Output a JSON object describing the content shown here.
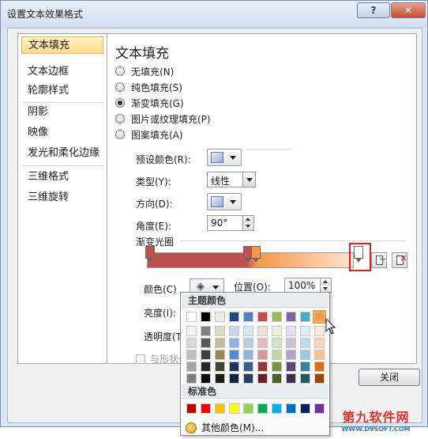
{
  "window": {
    "title": "设置文本效果格式",
    "help_label": "?",
    "close_label": "✕"
  },
  "nav": {
    "items": [
      {
        "label": "文本填充",
        "selected": true
      },
      {
        "label": "文本边框"
      },
      {
        "label": "轮廓样式"
      },
      {
        "label": "阴影"
      },
      {
        "label": "映像"
      },
      {
        "label": "发光和柔化边缘"
      },
      {
        "label": "三维格式"
      },
      {
        "label": "三维旋转"
      }
    ]
  },
  "panel": {
    "heading": "文本填充",
    "fill_options": [
      {
        "label": "无填充(N)"
      },
      {
        "label": "纯色填充(S)"
      },
      {
        "label": "渐变填充(G)",
        "selected": true
      },
      {
        "label": "图片或纹理填充(P)"
      },
      {
        "label": "图案填充(A)"
      }
    ],
    "preset_label": "预设颜色(R):",
    "type_label": "类型(Y):",
    "type_value": "线性",
    "direction_label": "方向(D):",
    "angle_label": "角度(E):",
    "angle_value": "90°",
    "gradient_stops_label": "渐变光圈",
    "color_label": "颜色(C)",
    "position_label": "位置(O):",
    "position_value": "100%",
    "brightness_label": "亮度(I):",
    "transparency_label": "透明度(T):",
    "rotate_with_shape_label": "与形状一",
    "close_button": "关闭"
  },
  "color_popup": {
    "theme_header": "主题颜色",
    "standard_header": "标准色",
    "more_colors": "其他颜色(M)...",
    "theme_top_row": [
      "#ffffff",
      "#000000",
      "#eeece1",
      "#1f497d",
      "#4f81bd",
      "#c0504d",
      "#9bbb59",
      "#8064a2",
      "#4bacc6",
      "#f79646"
    ],
    "theme_shades": [
      [
        "#f2f2f2",
        "#7f7f7f",
        "#ddd9c3",
        "#c6d9f0",
        "#dbe5f1",
        "#f2dcdb",
        "#ebf1dd",
        "#e5e0ec",
        "#dbeef3",
        "#fdeada"
      ],
      [
        "#d8d8d8",
        "#595959",
        "#c4bd97",
        "#8db3e2",
        "#b8cce4",
        "#e5b9b7",
        "#d7e3bc",
        "#ccc1d9",
        "#b7dde8",
        "#fbd5b5"
      ],
      [
        "#bfbfbf",
        "#3f3f3f",
        "#938953",
        "#548dd4",
        "#95b3d7",
        "#d99694",
        "#c3d69b",
        "#b2a2c7",
        "#92cddc",
        "#fac08f"
      ],
      [
        "#a5a5a5",
        "#262626",
        "#494429",
        "#17365d",
        "#366092",
        "#953734",
        "#76923c",
        "#5f497a",
        "#31859b",
        "#e36c09"
      ],
      [
        "#7f7f7f",
        "#0c0c0c",
        "#1d1b10",
        "#0f243e",
        "#244061",
        "#632423",
        "#4f6128",
        "#3f3151",
        "#205867",
        "#974806"
      ]
    ],
    "standard_colors": [
      "#c00000",
      "#ff0000",
      "#ffc000",
      "#ffff00",
      "#92d050",
      "#00b050",
      "#00b0f0",
      "#0070c0",
      "#002060",
      "#7030a0"
    ],
    "selected_index": 9
  },
  "watermark": {
    "title": "第九软件网",
    "url": "WWW.D9SOFT.COM"
  }
}
